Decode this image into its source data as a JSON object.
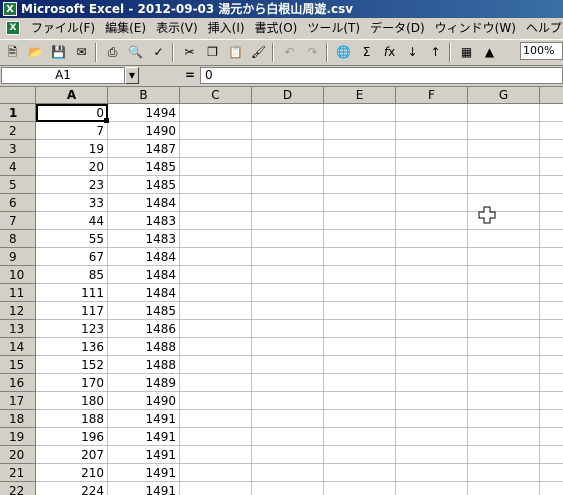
{
  "window": {
    "title": "Microsoft Excel - 2012-09-03 湯元から白根山周遊.csv"
  },
  "menu": [
    "ファイル(F)",
    "編集(E)",
    "表示(V)",
    "挿入(I)",
    "書式(O)",
    "ツール(T)",
    "データ(D)",
    "ウィンドウ(W)",
    "ヘルプ(H)"
  ],
  "toolbar": {
    "zoom": "100%"
  },
  "formula_bar": {
    "name_box": "A1",
    "eq": "=",
    "value": "0"
  },
  "columns": [
    "A",
    "B",
    "C",
    "D",
    "E",
    "F",
    "G"
  ],
  "rows": [
    [
      "1",
      "0",
      "1494"
    ],
    [
      "2",
      "7",
      "1490"
    ],
    [
      "3",
      "19",
      "1487"
    ],
    [
      "4",
      "20",
      "1485"
    ],
    [
      "5",
      "23",
      "1485"
    ],
    [
      "6",
      "33",
      "1484"
    ],
    [
      "7",
      "44",
      "1483"
    ],
    [
      "8",
      "55",
      "1483"
    ],
    [
      "9",
      "67",
      "1484"
    ],
    [
      "10",
      "85",
      "1484"
    ],
    [
      "11",
      "111",
      "1484"
    ],
    [
      "12",
      "117",
      "1485"
    ],
    [
      "13",
      "123",
      "1486"
    ],
    [
      "14",
      "136",
      "1488"
    ],
    [
      "15",
      "152",
      "1488"
    ],
    [
      "16",
      "170",
      "1489"
    ],
    [
      "17",
      "180",
      "1490"
    ],
    [
      "18",
      "188",
      "1491"
    ],
    [
      "19",
      "196",
      "1491"
    ],
    [
      "20",
      "207",
      "1491"
    ],
    [
      "21",
      "210",
      "1491"
    ],
    [
      "22",
      "224",
      "1491"
    ]
  ]
}
